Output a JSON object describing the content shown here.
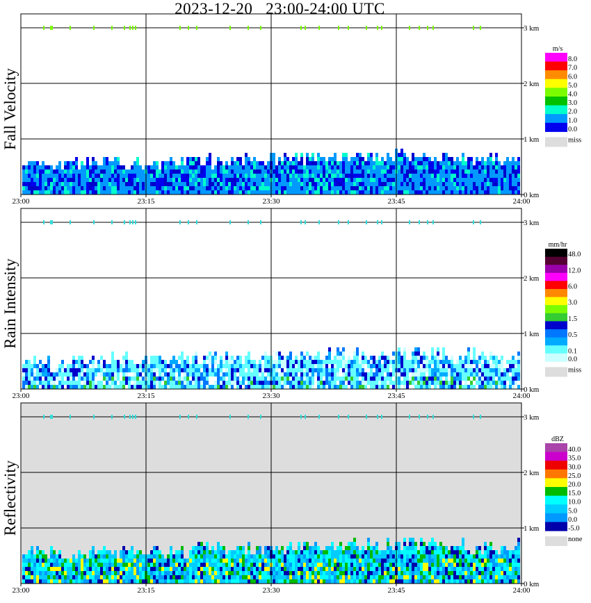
{
  "title": "2023-12-20   23:00-24:00 UTC",
  "chart_data": [
    {
      "type": "heatmap",
      "name_label": "Fall Velocity",
      "x_ticks": [
        "23:00",
        "23:15",
        "23:30",
        "23:45",
        "24:00"
      ],
      "y_ticks": [
        "0 km",
        "1 km",
        "2 km",
        "3 km"
      ],
      "xlim": [
        "23:00",
        "24:00"
      ],
      "ylim_km": [
        0,
        3.0
      ],
      "grid": true,
      "unit": "m/s",
      "legend": [
        {
          "label": "8.0",
          "color": "#ff00ff"
        },
        {
          "label": "7.0",
          "color": "#ff0000"
        },
        {
          "label": "6.0",
          "color": "#ff8c00"
        },
        {
          "label": "5.0",
          "color": "#ffff00"
        },
        {
          "label": "4.0",
          "color": "#7cfc00"
        },
        {
          "label": "3.0",
          "color": "#00c000"
        },
        {
          "label": "2.0",
          "color": "#00ffcc"
        },
        {
          "label": "1.0",
          "color": "#0099ff"
        },
        {
          "label": "0.0",
          "color": "#0000ee"
        }
      ],
      "miss_label": "miss",
      "miss_color": "#dddddd",
      "background": "#ffffff",
      "echo_top_km": {
        "minutes": [
          0,
          5,
          10,
          15,
          20,
          25,
          30,
          35,
          40,
          45,
          50,
          55,
          60
        ],
        "km": [
          0.62,
          0.6,
          0.64,
          0.6,
          0.66,
          0.66,
          0.7,
          0.72,
          0.74,
          0.78,
          0.74,
          0.7,
          0.72
        ]
      }
    },
    {
      "type": "heatmap",
      "name_label": "Rain Intensity",
      "x_ticks": [
        "23:00",
        "23:15",
        "23:30",
        "23:45",
        "24:00"
      ],
      "y_ticks": [
        "0 km",
        "1 km",
        "2 km",
        "3 km"
      ],
      "xlim": [
        "23:00",
        "24:00"
      ],
      "ylim_km": [
        0,
        3.0
      ],
      "grid": true,
      "unit": "mm/hr",
      "legend": [
        {
          "label": "48.0",
          "color": "#000000"
        },
        {
          "label": "",
          "color": "#550033"
        },
        {
          "label": "12.0",
          "color": "#9900aa"
        },
        {
          "label": "",
          "color": "#ff00ff"
        },
        {
          "label": "6.0",
          "color": "#ff0000"
        },
        {
          "label": "",
          "color": "#ff8800"
        },
        {
          "label": "3.0",
          "color": "#ffff00"
        },
        {
          "label": "",
          "color": "#7cfc00"
        },
        {
          "label": "1.5",
          "color": "#33cc33"
        },
        {
          "label": "",
          "color": "#0000cc"
        },
        {
          "label": "0.5",
          "color": "#0077ff"
        },
        {
          "label": "",
          "color": "#00aaff"
        },
        {
          "label": "0.1",
          "color": "#66ffff"
        },
        {
          "label": "0.0",
          "color": "#ccffff"
        }
      ],
      "miss_label": "miss",
      "miss_color": "#dddddd",
      "background": "#ffffff",
      "echo_top_km": {
        "minutes": [
          0,
          5,
          10,
          15,
          20,
          25,
          30,
          35,
          40,
          45,
          50,
          55,
          60
        ],
        "km": [
          0.55,
          0.55,
          0.6,
          0.6,
          0.62,
          0.62,
          0.65,
          0.68,
          0.7,
          0.74,
          0.72,
          0.68,
          0.7
        ]
      }
    },
    {
      "type": "heatmap",
      "name_label": "Reflectivity",
      "x_ticks": [
        "23:00",
        "23:15",
        "23:30",
        "23:45",
        "24:00"
      ],
      "y_ticks": [
        "0 km",
        "1 km",
        "2 km",
        "3 km"
      ],
      "xlim": [
        "23:00",
        "24:00"
      ],
      "ylim_km": [
        0,
        3.0
      ],
      "grid": true,
      "unit": "dBZ",
      "legend": [
        {
          "label": "40.0",
          "color": "#aa44aa"
        },
        {
          "label": "35.0",
          "color": "#cc00cc"
        },
        {
          "label": "30.0",
          "color": "#ee0000"
        },
        {
          "label": "25.0",
          "color": "#ff7700"
        },
        {
          "label": "20.0",
          "color": "#ffff00"
        },
        {
          "label": "15.0",
          "color": "#00bb00"
        },
        {
          "label": "10.0",
          "color": "#00ffff"
        },
        {
          "label": "5.0",
          "color": "#00ccff"
        },
        {
          "label": "0.0",
          "color": "#0099ff"
        },
        {
          "label": "-5.0",
          "color": "#0000aa"
        }
      ],
      "miss_label": "none",
      "miss_color": "#dddddd",
      "background": "#dddddd",
      "echo_top_km": {
        "minutes": [
          0,
          5,
          10,
          15,
          20,
          25,
          30,
          35,
          40,
          45,
          50,
          55,
          60
        ],
        "km": [
          0.6,
          0.6,
          0.65,
          0.6,
          0.66,
          0.68,
          0.7,
          0.72,
          0.75,
          0.8,
          0.76,
          0.72,
          0.74
        ]
      }
    }
  ]
}
